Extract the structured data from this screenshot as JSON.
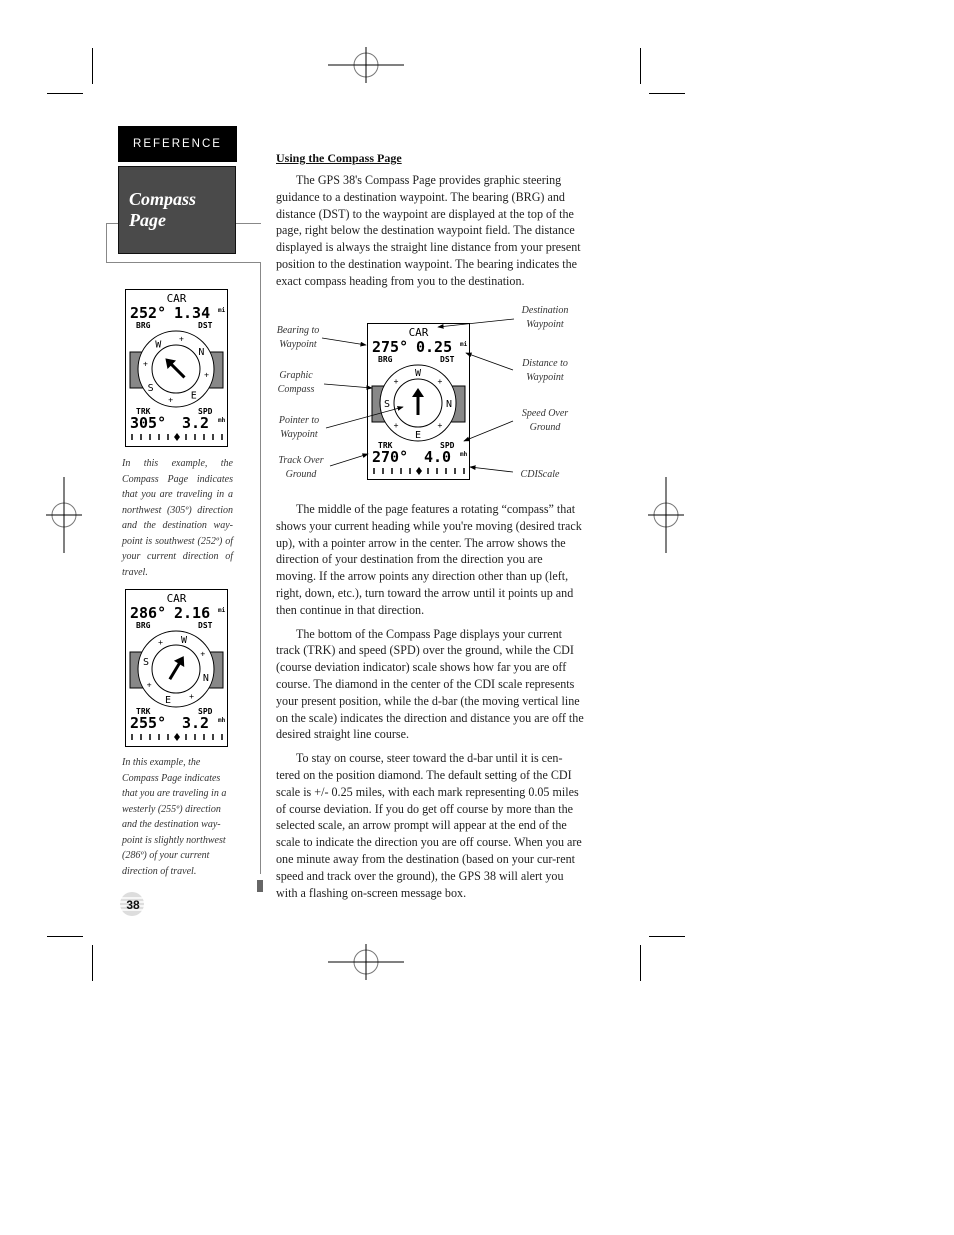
{
  "sidebar": {
    "section_tab": "REFERENCE",
    "page_title": "Compass Page",
    "captions": [
      "In this example, the Compass Page indicates that you are traveling in a northwest (305º) direction and the destination way-point is southwest (252º) of your current direction of travel.",
      "In this example, the Compass Page indicates that you are traveling in a westerly (255º) direction and the destination way-point is slightly northwest (286º) of your current direction of travel."
    ],
    "page_number": "38"
  },
  "screens": [
    {
      "waypoint": "CAR",
      "bearing": "252°",
      "distance": "1.34",
      "distance_unit": "mi",
      "brg_label": "BRG",
      "dst_label": "DST",
      "trk_label": "TRK",
      "spd_label": "SPD",
      "track": "305°",
      "speed": "3.2",
      "speed_unit": "mh",
      "compass_labels": [
        "W",
        "N",
        "E",
        "S"
      ],
      "arrow_heading_deg": 315,
      "ring_rotation_deg": 55
    },
    {
      "waypoint": "CAR",
      "bearing": "286°",
      "distance": "2.16",
      "distance_unit": "mi",
      "brg_label": "BRG",
      "dst_label": "DST",
      "trk_label": "TRK",
      "spd_label": "SPD",
      "track": "255°",
      "speed": "3.2",
      "speed_unit": "mh",
      "compass_labels": [
        "W",
        "N",
        "E",
        "S"
      ],
      "arrow_heading_deg": 31,
      "ring_rotation_deg": 105
    },
    {
      "waypoint": "CAR",
      "bearing": "275°",
      "distance": "0.25",
      "distance_unit": "mi",
      "brg_label": "BRG",
      "dst_label": "DST",
      "trk_label": "TRK",
      "spd_label": "SPD",
      "track": "270°",
      "speed": "4.0",
      "speed_unit": "mh",
      "compass_labels": [
        "W",
        "N",
        "E",
        "S"
      ],
      "arrow_heading_deg": 0,
      "ring_rotation_deg": 90
    }
  ],
  "main": {
    "heading": "Using the Compass Page",
    "paragraphs": [
      "The GPS 38's Compass Page provides graphic steering guidance to a destination waypoint. The bearing (BRG) and distance (DST) to the waypoint are displayed at the top of the page, right below the destination waypoint field. The distance displayed is always the straight line distance from your present position to the destination waypoint. The bearing indicates the exact compass heading from you to the destination.",
      "The middle of the page features a rotating “compass” that shows your current heading while you're moving (desired track up), with a pointer arrow in the center. The arrow shows the direction of your destination from the direction you are moving. If the arrow points any direction other than up (left, right, down, etc.), turn toward the arrow until it points up and then continue in that direction.",
      "The bottom of the Compass Page displays your current track (TRK) and speed (SPD) over the ground, while the CDI (course deviation indicator) scale shows how far you are off course. The diamond in the center of the CDI scale represents your present position, while the d-bar (the moving vertical line on the scale) indicates the direction and distance you are off the desired straight line course.",
      "To stay on course, steer toward the d-bar until it is cen-tered on the position diamond. The default setting of the CDI scale is +/- 0.25 miles, with each mark representing 0.05 miles of course deviation. If you do get off course by more than the selected scale, an arrow prompt will appear at the end of the scale to indicate the direction you are off course. When you are one minute away from the destination (based on your cur-rent speed and track over the ground), the GPS 38 will alert you with a flashing on-screen message box."
    ],
    "callouts": {
      "bearing": "Bearing to Waypoint",
      "compass": "Graphic Compass",
      "pointer": "Pointer to Waypoint",
      "track": "Track Over Ground",
      "destination": "Destination Waypoint",
      "distance": "Distance to Waypoint",
      "speed": "Speed Over Ground",
      "cdi": "CDIScale"
    }
  }
}
